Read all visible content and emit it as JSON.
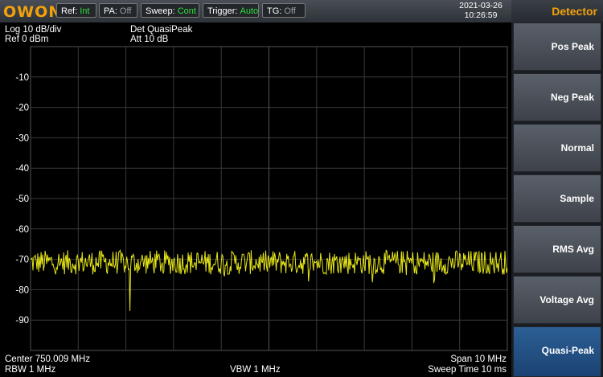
{
  "logo": "OWON",
  "status": {
    "ref": {
      "label": "Ref:",
      "value": "Int"
    },
    "pa": {
      "label": "PA:",
      "value": "Off"
    },
    "sweep": {
      "label": "Sweep:",
      "value": "Cont"
    },
    "trigger": {
      "label": "Trigger:",
      "value": "Auto"
    },
    "tg": {
      "label": "TG:",
      "value": "Off"
    }
  },
  "datetime": {
    "date": "2021-03-26",
    "time": "10:26:59"
  },
  "panel": {
    "title": "Detector",
    "items": [
      {
        "label": "Pos Peak",
        "active": false
      },
      {
        "label": "Neg Peak",
        "active": false
      },
      {
        "label": "Normal",
        "active": false
      },
      {
        "label": "Sample",
        "active": false
      },
      {
        "label": "RMS Avg",
        "active": false
      },
      {
        "label": "Voltage Avg",
        "active": false
      },
      {
        "label": "Quasi-Peak",
        "active": true
      }
    ]
  },
  "info": {
    "scale": "Log 10 dB/div",
    "ref": "Ref 0 dBm",
    "det": "Det QuasiPeak",
    "att": "Att 10 dB",
    "center": "Center 750.009 MHz",
    "rbw": "RBW 1 MHz",
    "vbw": "VBW 1 MHz",
    "span": "Span 10 MHz",
    "sweep_time": "Sweep Time 10 ms"
  },
  "colors": {
    "trace": "#e6e619",
    "accent": "#f2a10a",
    "active_key": "#1b4272"
  },
  "chart_data": {
    "type": "line",
    "ylim": [
      0,
      -100
    ],
    "y_ticks": [
      "-10",
      "-20",
      "-30",
      "-40",
      "-50",
      "-60",
      "-70",
      "-80",
      "-90"
    ],
    "x_range_mhz": [
      745.009,
      755.009
    ],
    "trace_mean_dbm": -71,
    "trace_noise_dbm": 4,
    "dip_dbm": -87
  }
}
